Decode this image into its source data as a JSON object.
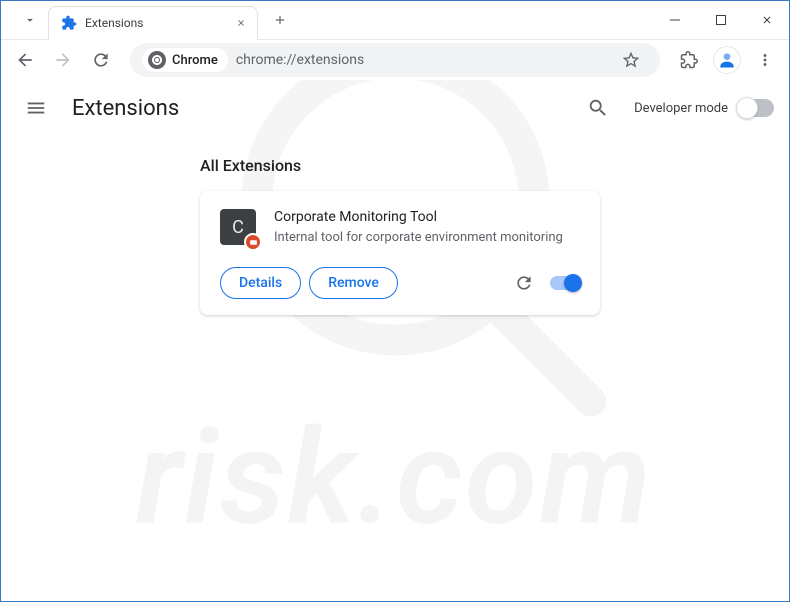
{
  "tab": {
    "title": "Extensions"
  },
  "omnibox": {
    "chip_label": "Chrome",
    "url": "chrome://extensions"
  },
  "header": {
    "title": "Extensions",
    "developer_mode_label": "Developer mode"
  },
  "section": {
    "title": "All Extensions"
  },
  "extension": {
    "icon_letter": "C",
    "name": "Corporate Monitoring Tool",
    "description": "Internal tool for corporate environment monitoring",
    "details_label": "Details",
    "remove_label": "Remove",
    "enabled": true
  },
  "watermark": {
    "text": "risk.com"
  }
}
